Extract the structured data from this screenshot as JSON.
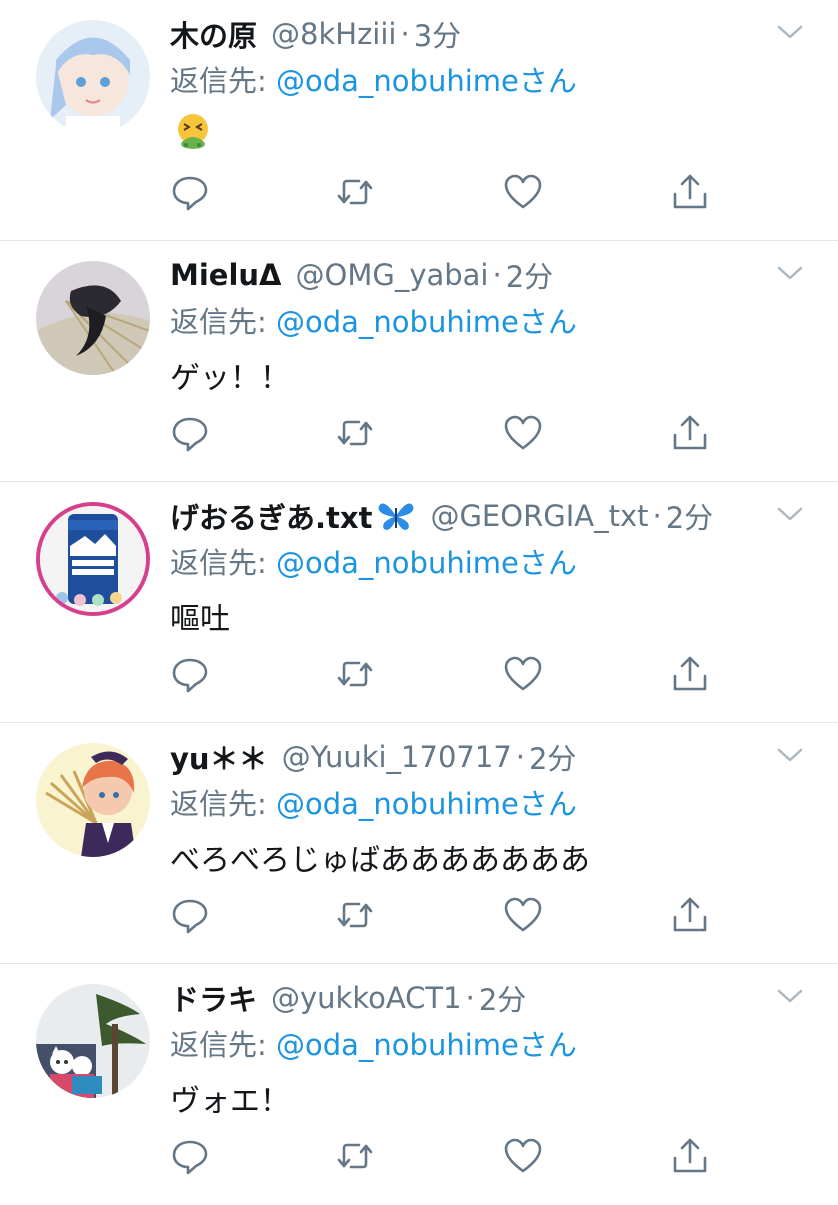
{
  "reply_label": "返信先: ",
  "reply_suffix": "さん",
  "tweets": [
    {
      "name": "木の原",
      "handle": "@8kHziii",
      "time": "3分",
      "reply_to": "@oda_nobuhime",
      "text": "",
      "emoji_icon": "nauseated-face-icon"
    },
    {
      "name": "MieluΔ",
      "handle": "@OMG_yabai",
      "time": "2分",
      "reply_to": "@oda_nobuhime",
      "text": "ゲッ！！"
    },
    {
      "name": "げおるぎあ.txt",
      "badge_icon": "butterfly-icon",
      "handle": "@GEORGIA_txt",
      "time": "2分",
      "reply_to": "@oda_nobuhime",
      "text": "嘔吐"
    },
    {
      "name": "yu＊＊",
      "handle": "@Yuuki_170717",
      "time": "2分",
      "reply_to": "@oda_nobuhime",
      "text": "べろべろじゅばあああああああ"
    },
    {
      "name": "ドラキ",
      "handle": "@yukkoACT1",
      "time": "2分",
      "reply_to": "@oda_nobuhime",
      "text": "ヴォエ！"
    }
  ],
  "colors": {
    "text": "#14171a",
    "secondary": "#657786",
    "link": "#1b95e0",
    "divider": "#e1e8ed"
  },
  "icons": [
    "reply-icon",
    "retweet-icon",
    "like-icon",
    "share-icon",
    "chevron-down-icon"
  ]
}
